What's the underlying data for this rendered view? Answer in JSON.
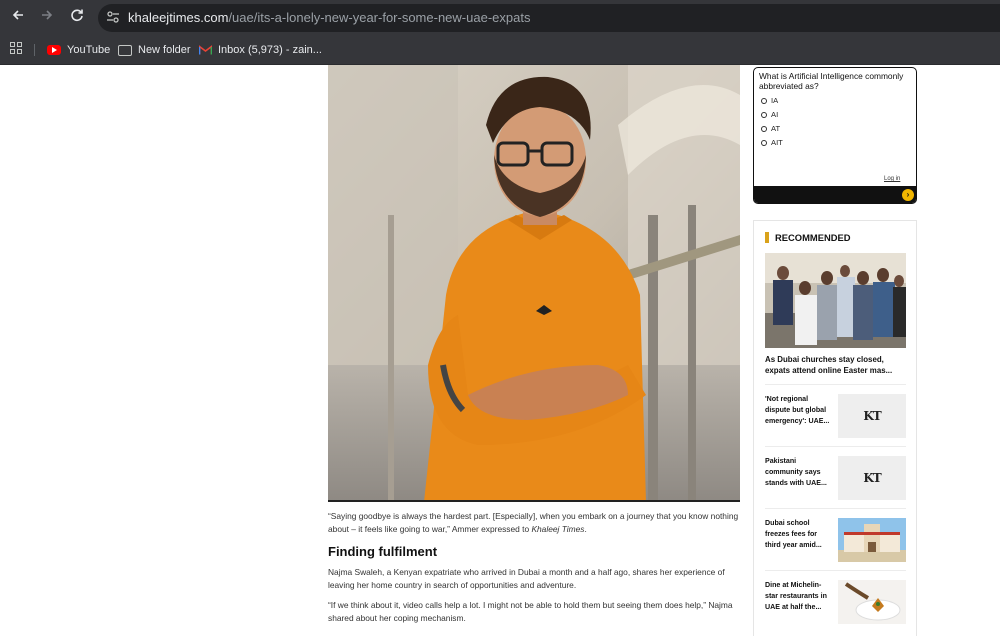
{
  "browser": {
    "url_domain": "khaleejtimes.com",
    "url_path": "/uae/its-a-lonely-new-year-for-some-new-uae-expats",
    "bookmarks": [
      {
        "label": "YouTube",
        "icon": "youtube-icon"
      },
      {
        "label": "New folder",
        "icon": "folder-icon"
      },
      {
        "label": "Inbox (5,973) - zain...",
        "icon": "gmail-icon"
      }
    ]
  },
  "article": {
    "quote1_a": "“Saying goodbye is always the hardest part. [Especially], when you embark on a journey that you know nothing about – it feels like going to war,” Ammer expressed to ",
    "quote1_pub": "Khaleej Times",
    "quote1_end": ".",
    "heading": "Finding fulfilment",
    "para2": "Najma Swaleh, a Kenyan expatriate who arrived in Dubai a month and a half ago, shares her experience of leaving her home country in search of opportunities and adventure.",
    "para3": "“If we think about it, video calls help a lot. I might not be able to hold them but seeing them does help,” Najma shared about her coping mechanism."
  },
  "poll": {
    "question": "What is Artificial Intelligence commonly abbreviated as?",
    "options": [
      "IA",
      "AI",
      "AT",
      "AIT"
    ],
    "login_label": "Log in",
    "next_glyph": "›"
  },
  "recommended": {
    "title": "RECOMMENDED",
    "hero_caption": "As Dubai churches stay closed, expats attend online Easter mas...",
    "items": [
      {
        "text": "'Not regional dispute but global emergency': UAE...",
        "thumb_logo": "KT"
      },
      {
        "text": "Pakistani community says stands with UAE...",
        "thumb_logo": "KT"
      },
      {
        "text": "Dubai school freezes fees for third year amid..."
      },
      {
        "text": "Dine at Michelin-star restaurants in UAE at half the..."
      }
    ]
  },
  "colors": {
    "chrome": "#35363a",
    "omnibox": "#202124",
    "accent_gold": "#d9a21b",
    "poll_next": "#f2b600"
  }
}
